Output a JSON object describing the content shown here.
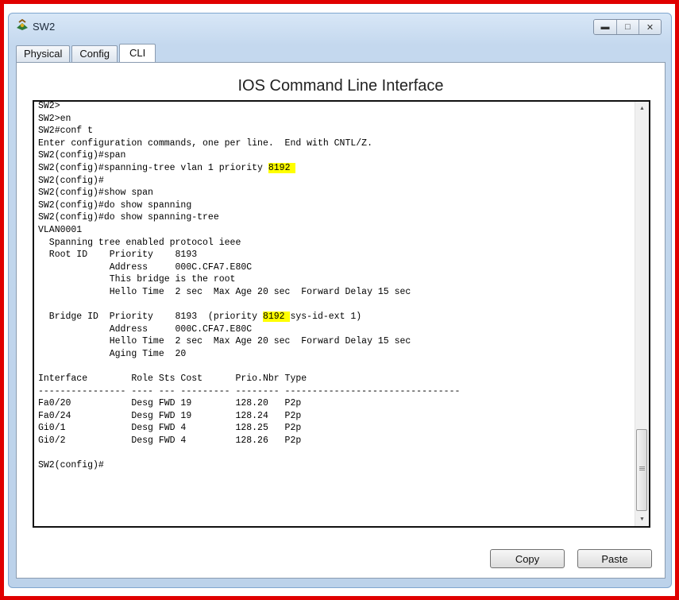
{
  "window": {
    "title": "SW2",
    "icon": "switch-icon",
    "controls": {
      "minimize": "minimize-icon",
      "maximize": "maximize-icon",
      "close": "close-icon"
    }
  },
  "tabs": [
    {
      "label": "Physical",
      "active": false
    },
    {
      "label": "Config",
      "active": false
    },
    {
      "label": "CLI",
      "active": true
    }
  ],
  "cli": {
    "heading": "IOS Command Line Interface",
    "highlight_color": "#ffff00",
    "lines": [
      {
        "text": "SW2>"
      },
      {
        "text": "SW2>en"
      },
      {
        "text": "SW2#conf t"
      },
      {
        "text": "Enter configuration commands, one per line.  End with CNTL/Z."
      },
      {
        "text": "SW2(config)#span"
      },
      {
        "pre": "SW2(config)#spanning-tree vlan 1 priority ",
        "hl": "8192 ",
        "post": ""
      },
      {
        "text": "SW2(config)#"
      },
      {
        "text": "SW2(config)#show span"
      },
      {
        "text": "SW2(config)#do show spanning"
      },
      {
        "text": "SW2(config)#do show spanning-tree"
      },
      {
        "text": "VLAN0001"
      },
      {
        "text": "  Spanning tree enabled protocol ieee"
      },
      {
        "text": "  Root ID    Priority    8193"
      },
      {
        "text": "             Address     000C.CFA7.E80C"
      },
      {
        "text": "             This bridge is the root"
      },
      {
        "text": "             Hello Time  2 sec  Max Age 20 sec  Forward Delay 15 sec"
      },
      {
        "text": ""
      },
      {
        "pre": "  Bridge ID  Priority    8193  (priority ",
        "hl": "8192 ",
        "post": "sys-id-ext 1)"
      },
      {
        "text": "             Address     000C.CFA7.E80C"
      },
      {
        "text": "             Hello Time  2 sec  Max Age 20 sec  Forward Delay 15 sec"
      },
      {
        "text": "             Aging Time  20"
      },
      {
        "text": ""
      },
      {
        "text": "Interface        Role Sts Cost      Prio.Nbr Type"
      },
      {
        "text": "---------------- ---- --- --------- -------- --------------------------------"
      },
      {
        "text": "Fa0/20           Desg FWD 19        128.20   P2p"
      },
      {
        "text": "Fa0/24           Desg FWD 19        128.24   P2p"
      },
      {
        "text": "Gi0/1            Desg FWD 4         128.25   P2p"
      },
      {
        "text": "Gi0/2            Desg FWD 4         128.26   P2p"
      },
      {
        "text": ""
      },
      {
        "text": "SW2(config)#"
      }
    ]
  },
  "buttons": {
    "copy": "Copy",
    "paste": "Paste"
  }
}
